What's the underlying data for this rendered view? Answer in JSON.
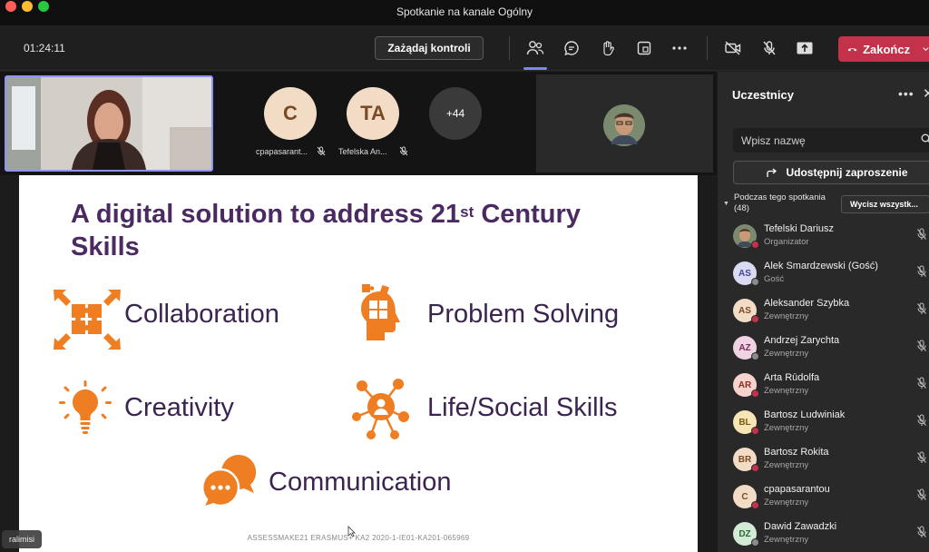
{
  "window": {
    "title": "Spotkanie na kanale Ogólny"
  },
  "toolbar": {
    "timer": "01:24:11",
    "request_control": "Zażądaj kontroli",
    "end_call": "Zakończ"
  },
  "video_strip": {
    "tiles": [
      {
        "initials": "C",
        "name": "cpapasarant...",
        "bg": "#f3dcc6",
        "fg": "#7a4a24"
      },
      {
        "initials": "TA",
        "name": "Tefelska An...",
        "bg": "#f3dcc6",
        "fg": "#7a4a24"
      },
      {
        "initials": "+44",
        "name": "",
        "bg": "#3a3a3a",
        "fg": "#ffffff"
      }
    ]
  },
  "slide": {
    "title_part1": "A digital solution to address 21",
    "title_sup": "st",
    "title_part2": " Century",
    "title_line2": "Skills",
    "skills": {
      "collaboration": "Collaboration",
      "problem_solving": "Problem Solving",
      "creativity": "Creativity",
      "life_social": "Life/Social Skills",
      "communication": "Communication"
    },
    "footer": "ASSESSMAKE21 ERASMUS+ KA2 2020-1-IE01-KA201-065969",
    "accent": "#ef7d22"
  },
  "presenter_name": "ralimisi",
  "panel": {
    "title": "Uczestnicy",
    "search_placeholder": "Wpisz nazwę",
    "share_invite": "Udostępnij zaproszenie",
    "section_line1": "Podczas tego spotkania",
    "section_line2": "(48)",
    "mute_all": "Wycisz wszystk...",
    "participants": [
      {
        "initials": "",
        "name": "Tefelski Dariusz",
        "role": "Organizator",
        "bg": "#6d5a4a",
        "fg": "#fff",
        "status": "#c4314b"
      },
      {
        "initials": "AS",
        "name": "Alek Smardzewski (Gość)",
        "role": "Gość",
        "bg": "#d9dbf3",
        "fg": "#444791",
        "status": "#8a8a8a"
      },
      {
        "initials": "AS",
        "name": "Aleksander Szybka",
        "role": "Zewnętrzny",
        "bg": "#f3dcc6",
        "fg": "#7a4a24",
        "status": "#c4314b"
      },
      {
        "initials": "AZ",
        "name": "Andrzej Zarychta",
        "role": "Zewnętrzny",
        "bg": "#efd3e3",
        "fg": "#7a2d57",
        "status": "#8a8a8a"
      },
      {
        "initials": "AR",
        "name": "Arta Rūdolfa",
        "role": "Zewnętrzny",
        "bg": "#f6d3cc",
        "fg": "#8a2f22",
        "status": "#c4314b"
      },
      {
        "initials": "BL",
        "name": "Bartosz Ludwiniak",
        "role": "Zewnętrzny",
        "bg": "#f7e5b5",
        "fg": "#7a5a10",
        "status": "#c4314b"
      },
      {
        "initials": "BR",
        "name": "Bartosz Rokita",
        "role": "Zewnętrzny",
        "bg": "#f3dcc6",
        "fg": "#7a4a24",
        "status": "#c4314b"
      },
      {
        "initials": "C",
        "name": "cpapasarantou",
        "role": "Zewnętrzny",
        "bg": "#f3dcc6",
        "fg": "#7a4a24",
        "status": "#c4314b"
      },
      {
        "initials": "DZ",
        "name": "Dawid Zawadzki",
        "role": "Zewnętrzny",
        "bg": "#d3ead7",
        "fg": "#2b6a36",
        "status": "#8a8a8a"
      }
    ]
  }
}
